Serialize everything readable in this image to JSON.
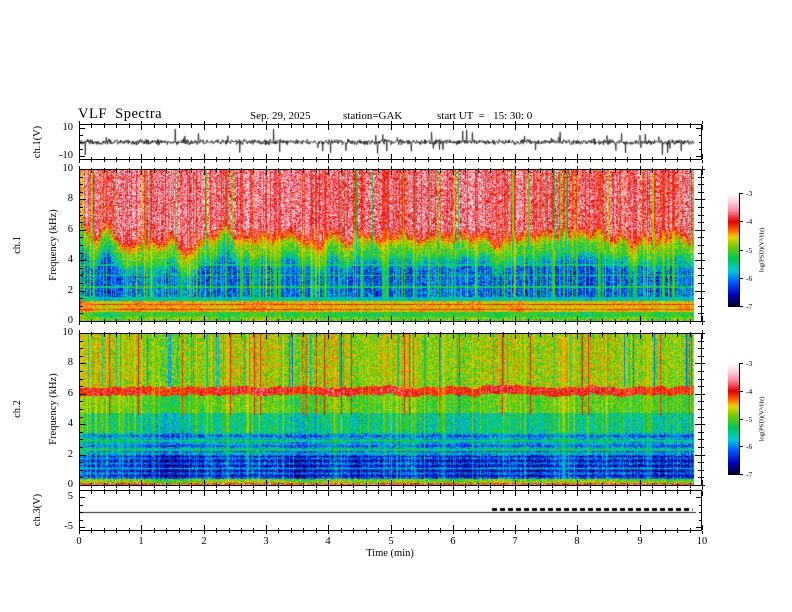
{
  "chart_data": {
    "type": "heatmap",
    "title": "VLF  Spectra",
    "date": "Sep. 29, 2025",
    "station": "station=GAK",
    "start_ut": "start UT  =   15: 30: 0",
    "xlabel": "Time (min)",
    "x_range_min": [
      0,
      10
    ],
    "x_major_ticks": [
      "0",
      "1",
      "2",
      "3",
      "4",
      "5",
      "6",
      "7",
      "8",
      "9",
      "10"
    ],
    "x_minor_step_min": 0.2,
    "data_end_min": 9.85,
    "panels": [
      {
        "id": "ch1-waveform",
        "kind": "line",
        "ylabel": "ch.1(V)",
        "y_range_v": [
          -10,
          10
        ],
        "y_tick_labels": [
          "10",
          "-10"
        ],
        "y_tick_values": [
          10,
          -10
        ],
        "description": "broadband noise of about ±1.5 V with frequent impulsive sferic spikes reaching ±9 V, trace ends near 9.85 min",
        "signal": {
          "noise_v": 1.25,
          "spike_prob": 0.042,
          "spike_v_min": 2.5,
          "spike_v_max": 9,
          "n_samples": 1400
        }
      },
      {
        "id": "ch1-spectrogram",
        "kind": "spectrogram",
        "ylabel_lines": [
          "ch.1",
          "Frequency (kHz)"
        ],
        "y_range_khz": [
          0,
          10
        ],
        "y_tick_labels": [
          "0",
          "2",
          "4",
          "6",
          "8",
          "10"
        ],
        "y_tick_values": [
          0,
          2,
          4,
          6,
          8,
          10
        ],
        "psd_range_log": [
          -7,
          -3
        ],
        "description": "intense red hiss above ~5 kHz with ragged lower edge, blue background 1.5-4.5 kHz crossed by cyan vertical striations, yellow-green band 0.55-1.3 kHz containing thin red lines near 1.05 and 0.75 kHz, green-cyan mottle below 0.5 kHz",
        "model": {
          "boundary_khz": 5.2,
          "boundary_wobble_khz": 1.15,
          "v_red": -3.6,
          "v_mid": -5.1,
          "v_blue": -6.25,
          "noise": 0.5,
          "low_bands": [
            {
              "f_lo": 1.3,
              "f_hi": 1.55,
              "v": -5.7,
              "noise": 0.3
            },
            {
              "f_lo": 0.55,
              "f_hi": 1.3,
              "v": -4.55,
              "noise": 0.28
            },
            {
              "f_lo": 0.25,
              "f_hi": 0.55,
              "v": -5.25,
              "noise": 0.35
            },
            {
              "f_lo": 0.0,
              "f_hi": 0.25,
              "v": -5.0,
              "noise": 0.45
            }
          ],
          "red_lines": [
            {
              "f": 1.06,
              "hw": 0.05,
              "v": -3.85
            },
            {
              "f": 0.74,
              "hw": 0.04,
              "v": -4.15
            }
          ],
          "cyan_lines": [
            {
              "f": 2.25,
              "hw": 0.06,
              "v": -5.5
            },
            {
              "f": 3.0,
              "hw": 0.05,
              "v": -5.55
            },
            {
              "f": 3.7,
              "hw": 0.05,
              "v": -5.6
            }
          ],
          "striation_prob": 0.55,
          "striation_target": -4.6,
          "dark_striation_prob": 0.08,
          "dark_striation_target": -6.1
        }
      },
      {
        "id": "ch2-spectrogram",
        "kind": "spectrogram",
        "ylabel_lines": [
          "ch.2",
          "Frequency (kHz)"
        ],
        "y_range_khz": [
          0,
          10
        ],
        "y_tick_labels": [
          "0",
          "2",
          "4",
          "6",
          "8",
          "10"
        ],
        "y_tick_values": [
          0,
          2,
          4,
          6,
          8,
          10
        ],
        "psd_range_log": [
          -7,
          -3
        ],
        "description": "green-cyan striated field above 6.5 kHz with sparse red and dark columns, solid red hiss band 6.0-6.5 kHz, green 4.8-6 kHz, cyan-blue 3.4-4.8 kHz, blue 1.9-3.4 kHz with cyan lines near 2.3 and 2.9 kHz, dark navy 0.4-1.9 kHz, green strip at bottom with red edge row",
        "model": {
          "bands": [
            {
              "f_lo": 6.5,
              "f_hi": 10.0,
              "v": -4.8,
              "noise": 0.5
            },
            {
              "f_lo": 5.95,
              "f_hi": 6.5,
              "v": -3.9,
              "noise": 0.3
            },
            {
              "f_lo": 4.8,
              "f_hi": 5.95,
              "v": -5.05,
              "noise": 0.4
            },
            {
              "f_lo": 3.4,
              "f_hi": 4.8,
              "v": -5.55,
              "noise": 0.45
            },
            {
              "f_lo": 1.9,
              "f_hi": 3.4,
              "v": -6.0,
              "noise": 0.5
            },
            {
              "f_lo": 0.4,
              "f_hi": 1.9,
              "v": -6.4,
              "noise": 0.45
            },
            {
              "f_lo": 0.12,
              "f_hi": 0.4,
              "v": -4.9,
              "noise": 0.4
            },
            {
              "f_lo": 0.0,
              "f_hi": 0.12,
              "v": -3.95,
              "noise": 0.6
            }
          ],
          "band_wobble_khz": 0.15,
          "cyan_lines": [
            {
              "f": 2.3,
              "hw": 0.07,
              "v": -5.4
            },
            {
              "f": 2.9,
              "hw": 0.06,
              "v": -5.45
            },
            {
              "f": 1.05,
              "hw": 0.05,
              "v": -5.8
            }
          ],
          "h_banding": {
            "f_lo": 0.4,
            "f_hi": 3.4,
            "amp": 0.26,
            "freq": 19
          },
          "striation_prob": 0.5,
          "striation_target": -4.5,
          "striation_strong_fmin": 3.4,
          "dark_striation_prob": 0.06,
          "dark_striation_target": -6.5,
          "dark_fmin": 6.5,
          "red_spike_prob": 0.026,
          "red_spike_v": -4.05,
          "red_spike_fmin": 4.6
        }
      },
      {
        "id": "ch3-line",
        "kind": "line",
        "ylabel": "ch.3(V)",
        "y_range_v": [
          -6.7,
          6.7
        ],
        "y_tick_labels": [
          "5",
          "-5"
        ],
        "y_tick_values": [
          5,
          -5
        ],
        "description": "flat trace near 0 V across full record; thick black dotted segment slightly above it from ~6.63 min to ~9.85 min",
        "signal": {
          "flat_v": -0.3,
          "dotted_v": 0.7,
          "dotted_start_min": 6.63,
          "dotted_end_min": 9.85
        }
      }
    ],
    "colorbars": [
      {
        "label": "log(PSD)(V²/Hz)",
        "tick_labels": [
          "-3",
          "-4",
          "-5",
          "-6",
          "-7"
        ],
        "range_log": [
          -7,
          -3
        ]
      },
      {
        "label": "log(PSD)(V²/Hz)",
        "tick_labels": [
          "-3",
          "-4",
          "-5",
          "-6",
          "-7"
        ],
        "range_log": [
          -7,
          -3
        ]
      }
    ],
    "colormap_stops": [
      [
        -7.0,
        "#050024"
      ],
      [
        -6.6,
        "#0000b4"
      ],
      [
        -6.15,
        "#0055ff"
      ],
      [
        -5.75,
        "#00c8d8"
      ],
      [
        -5.3,
        "#00c855"
      ],
      [
        -4.9,
        "#6ecc00"
      ],
      [
        -4.55,
        "#e8d400"
      ],
      [
        -4.3,
        "#ff6400"
      ],
      [
        -4.0,
        "#e00000"
      ],
      [
        -3.6,
        "#ff8ca5"
      ],
      [
        -3.25,
        "#ffd8e0"
      ],
      [
        -3.0,
        "#ffffff"
      ]
    ]
  }
}
